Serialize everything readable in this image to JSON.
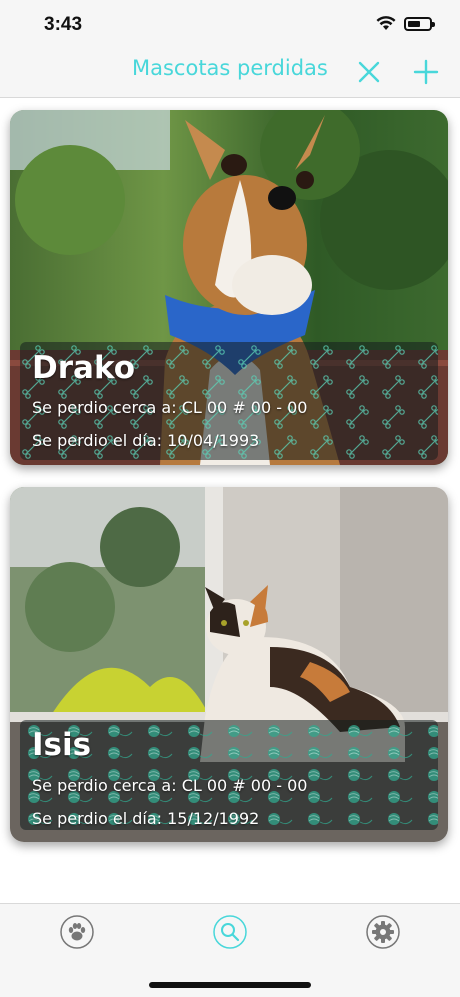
{
  "status": {
    "time": "3:43"
  },
  "nav": {
    "title": "Mascotas perdidas"
  },
  "pets": [
    {
      "name": "Drako",
      "location_line": "Se perdio cerca a: CL 00 # 00 - 00",
      "date_line": "Se perdio el día: 10/04/1993"
    },
    {
      "name": "Isis",
      "location_line": "Se perdio cerca a: CL 00 # 00 - 00",
      "date_line": "Se perdio el día: 15/12/1992"
    }
  ],
  "tabs": [
    {
      "icon": "paw-icon"
    },
    {
      "icon": "search-icon",
      "selected": true
    },
    {
      "icon": "gear-icon"
    }
  ],
  "colors": {
    "accent": "#48d7da",
    "bar": "#f6f6f6"
  }
}
